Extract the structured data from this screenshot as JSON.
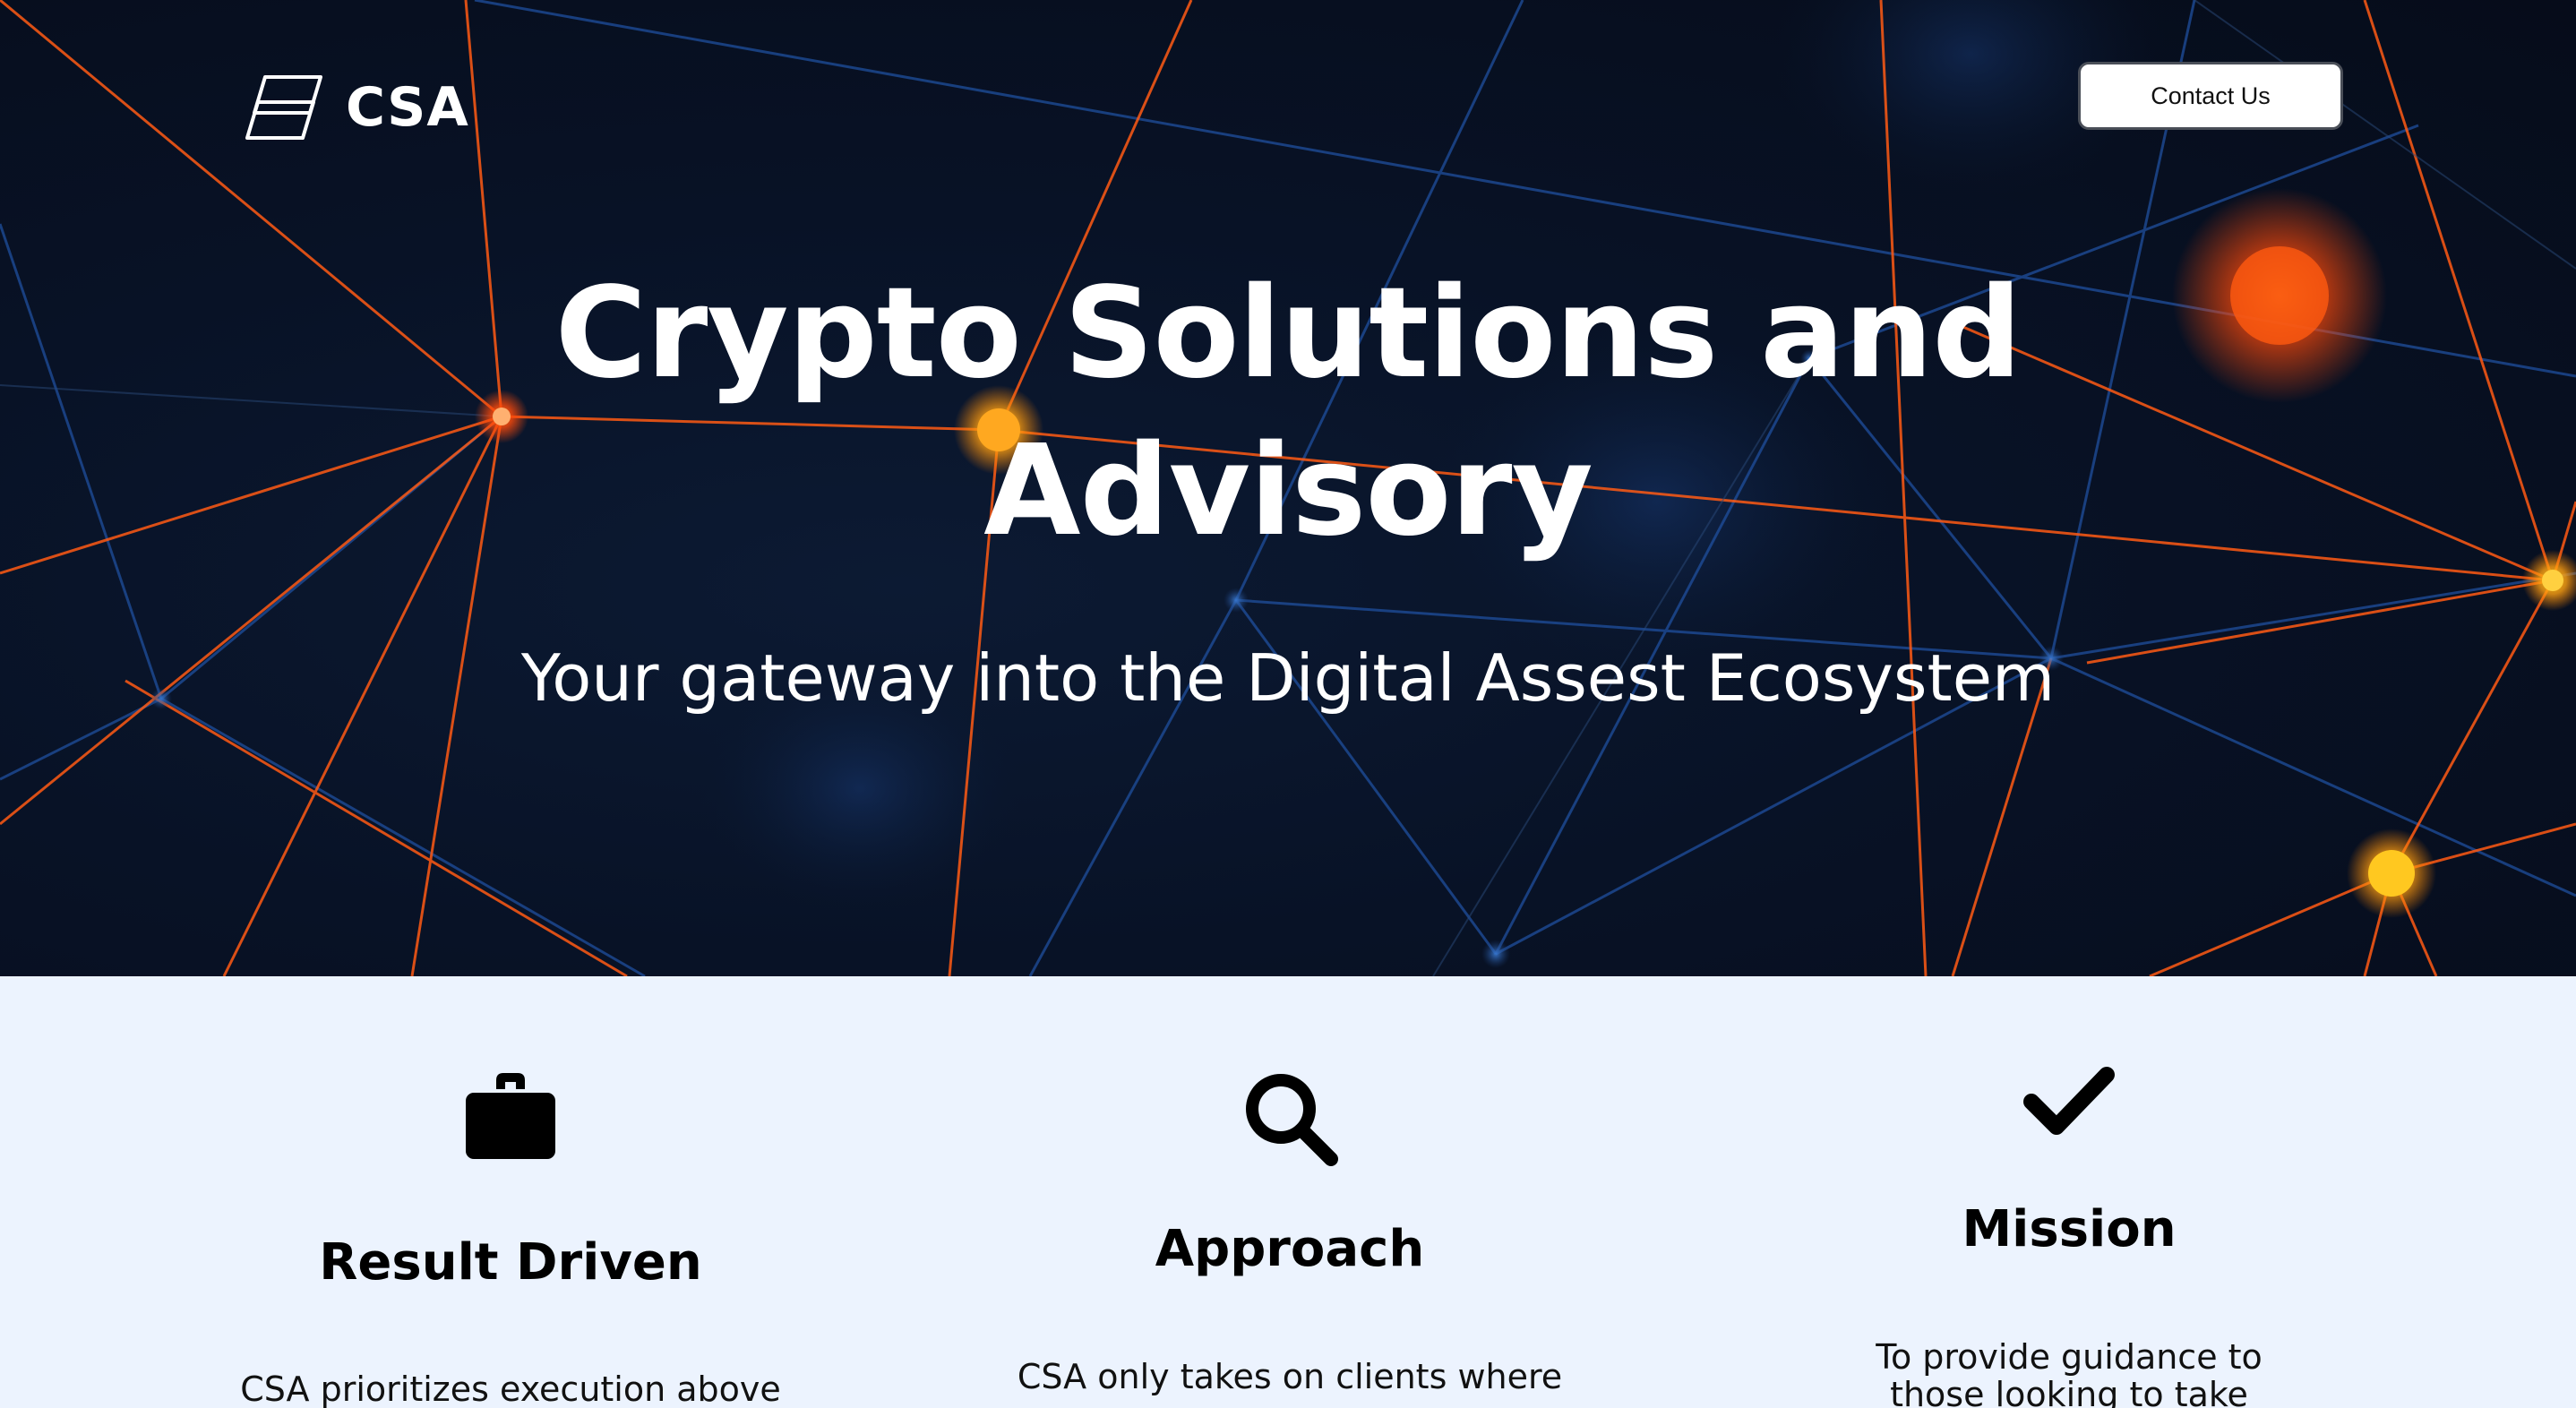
{
  "header": {
    "logo_text": "CSA",
    "contact_label": "Contact Us"
  },
  "hero": {
    "title_line1": "Crypto Solutions and",
    "title_line2": "Advisory",
    "subtitle": "Your gateway into the Digital Assest Ecosystem"
  },
  "features": [
    {
      "icon": "briefcase-icon",
      "title": "Result Driven",
      "text": "CSA prioritizes execution above"
    },
    {
      "icon": "search-icon",
      "title": "Approach",
      "text": "CSA only takes on clients where"
    },
    {
      "icon": "checkmark-icon",
      "title": "Mission",
      "text": "To provide guidance to those looking to take action in this"
    }
  ],
  "colors": {
    "hero_background": "#081226",
    "network_orange": "#ff6a1a",
    "network_blue": "#1f4f9e",
    "section_background": "#ecf3fe",
    "heading_text": "#000000"
  }
}
